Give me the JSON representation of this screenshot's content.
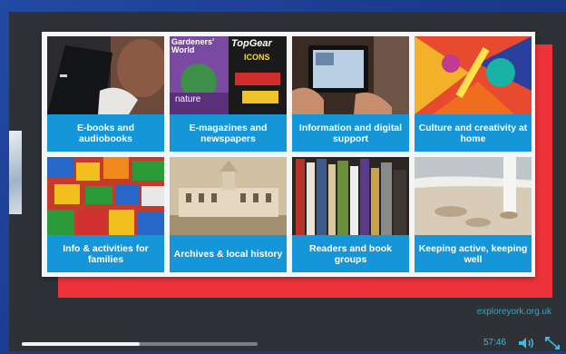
{
  "site_url": "exploreyork.org.uk",
  "tiles": [
    {
      "label": "E-books and audiobooks"
    },
    {
      "label": "E-magazines and newspapers"
    },
    {
      "label": "Information and digital support"
    },
    {
      "label": "Culture and creativity at home"
    },
    {
      "label": "Info & activities for families"
    },
    {
      "label": "Archives & local history"
    },
    {
      "label": "Readers and book groups"
    },
    {
      "label": "Keeping active, keeping well"
    }
  ],
  "magazine": {
    "title1": "Gardeners' World",
    "title2": "TopGear",
    "subtitle": "nature",
    "badge": "ICONS"
  },
  "player": {
    "time": "57:46",
    "progress": 0.5
  },
  "colors": {
    "accent": "#1496d8",
    "red": "#ee3239",
    "dark": "#2e3136",
    "time": "#3fb8e6"
  },
  "icons": {
    "volume": "volume-icon",
    "fullscreen": "fullscreen-icon"
  }
}
